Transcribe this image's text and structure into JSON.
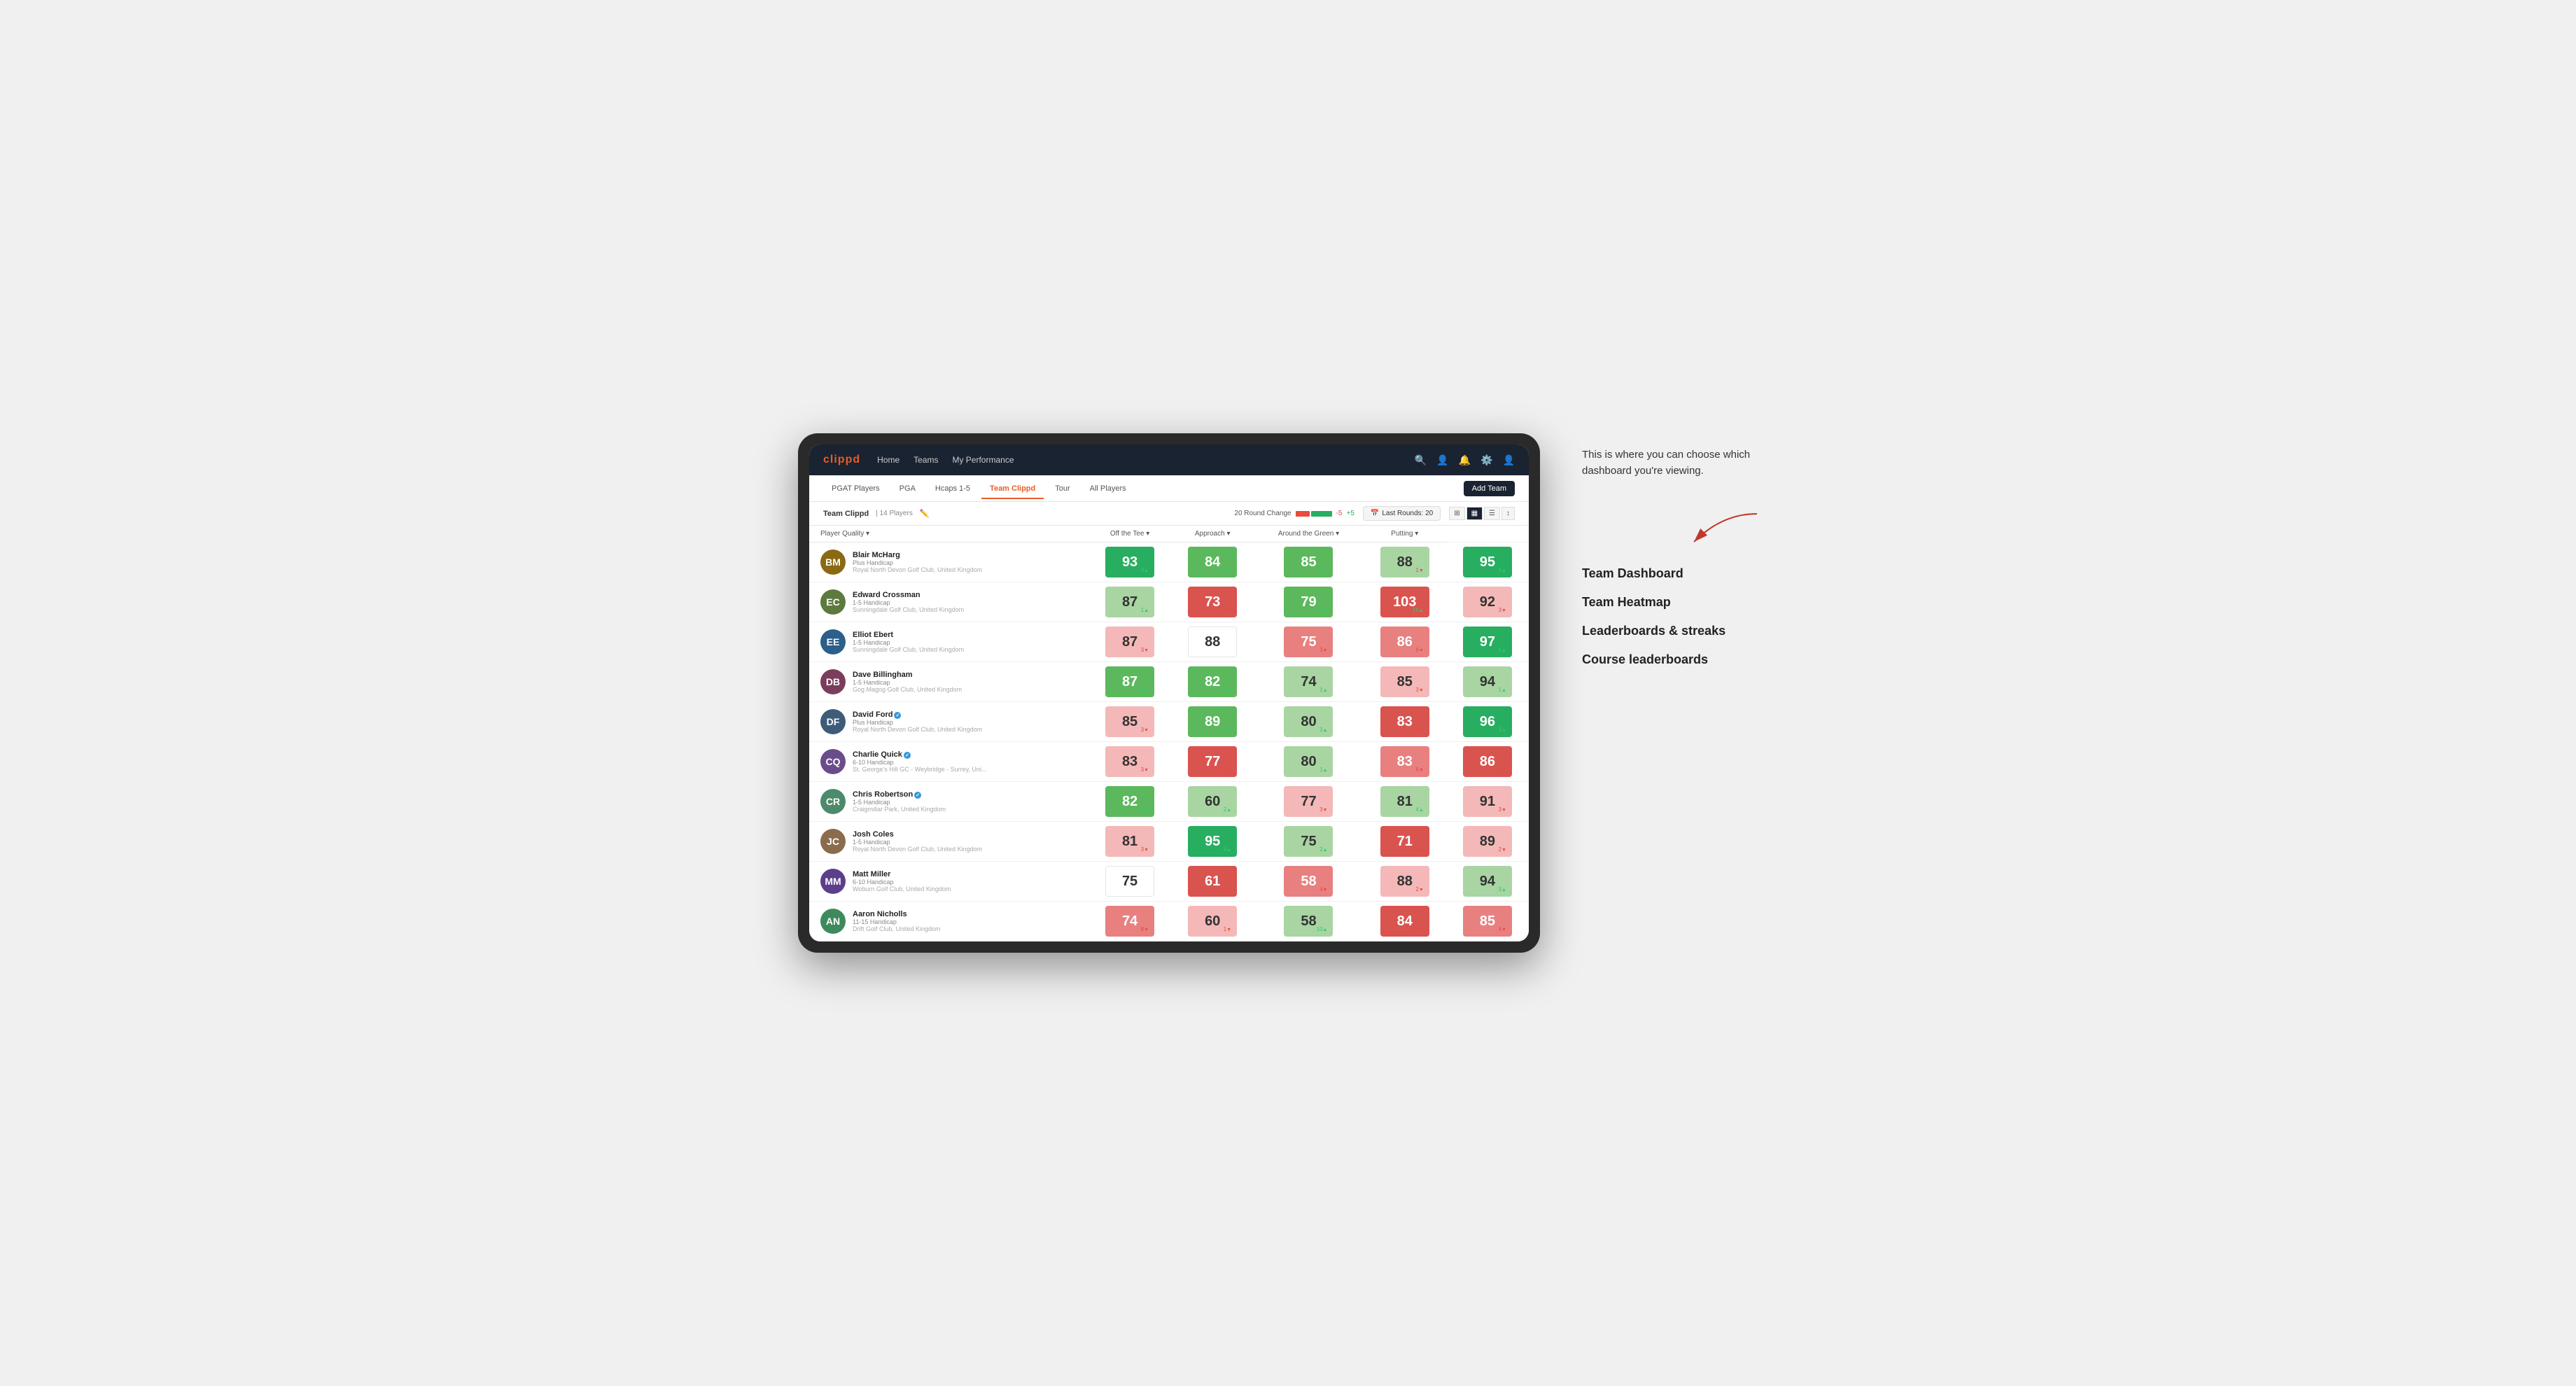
{
  "app": {
    "logo": "clippd",
    "nav_links": [
      "Home",
      "Teams",
      "My Performance"
    ],
    "tabs": [
      "PGAT Players",
      "PGA",
      "Hcaps 1-5",
      "Team Clippd",
      "Tour",
      "All Players"
    ],
    "active_tab": "Team Clippd",
    "add_team_label": "Add Team"
  },
  "sub_header": {
    "team_name": "Team Clippd",
    "separator": "|",
    "player_count": "14 Players",
    "round_change_label": "20 Round Change",
    "change_minus": "-5",
    "change_plus": "+5",
    "last_rounds_label": "Last Rounds:",
    "last_rounds_value": "20"
  },
  "table": {
    "columns": [
      "Player Quality ▾",
      "Off the Tee ▾",
      "Approach ▾",
      "Around the Green ▾",
      "Putting ▾"
    ],
    "rows": [
      {
        "name": "Blair McHarg",
        "handicap": "Plus Handicap",
        "club": "Royal North Devon Golf Club, United Kingdom",
        "scores": [
          {
            "value": "93",
            "change": "9",
            "dir": "up",
            "color": "green-dark"
          },
          {
            "value": "84",
            "change": "6",
            "dir": "up",
            "color": "green-light"
          },
          {
            "value": "85",
            "change": "8",
            "dir": "up",
            "color": "green-light"
          },
          {
            "value": "88",
            "change": "1",
            "dir": "down",
            "color": "green-pale"
          },
          {
            "value": "95",
            "change": "9",
            "dir": "up",
            "color": "green-dark"
          }
        ]
      },
      {
        "name": "Edward Crossman",
        "handicap": "1-5 Handicap",
        "club": "Sunningdale Golf Club, United Kingdom",
        "scores": [
          {
            "value": "87",
            "change": "1",
            "dir": "up",
            "color": "green-pale"
          },
          {
            "value": "73",
            "change": "11",
            "dir": "down",
            "color": "red-dark"
          },
          {
            "value": "79",
            "change": "9",
            "dir": "up",
            "color": "green-light"
          },
          {
            "value": "103",
            "change": "15",
            "dir": "up",
            "color": "red-dark"
          },
          {
            "value": "92",
            "change": "3",
            "dir": "down",
            "color": "red-pale"
          }
        ]
      },
      {
        "name": "Elliot Ebert",
        "handicap": "1-5 Handicap",
        "club": "Sunningdale Golf Club, United Kingdom",
        "scores": [
          {
            "value": "87",
            "change": "3",
            "dir": "down",
            "color": "red-pale"
          },
          {
            "value": "88",
            "change": "",
            "dir": "",
            "color": "white-bg"
          },
          {
            "value": "75",
            "change": "3",
            "dir": "down",
            "color": "red-light"
          },
          {
            "value": "86",
            "change": "6",
            "dir": "down",
            "color": "red-light"
          },
          {
            "value": "97",
            "change": "5",
            "dir": "up",
            "color": "green-dark"
          }
        ]
      },
      {
        "name": "Dave Billingham",
        "handicap": "1-5 Handicap",
        "club": "Gog Magog Golf Club, United Kingdom",
        "scores": [
          {
            "value": "87",
            "change": "4",
            "dir": "up",
            "color": "green-light"
          },
          {
            "value": "82",
            "change": "4",
            "dir": "up",
            "color": "green-light"
          },
          {
            "value": "74",
            "change": "1",
            "dir": "up",
            "color": "green-pale"
          },
          {
            "value": "85",
            "change": "3",
            "dir": "down",
            "color": "red-pale"
          },
          {
            "value": "94",
            "change": "1",
            "dir": "up",
            "color": "green-pale"
          }
        ]
      },
      {
        "name": "David Ford",
        "handicap": "Plus Handicap",
        "club": "Royal North Devon Golf Club, United Kingdom",
        "verified": true,
        "scores": [
          {
            "value": "85",
            "change": "3",
            "dir": "down",
            "color": "red-pale"
          },
          {
            "value": "89",
            "change": "7",
            "dir": "up",
            "color": "green-light"
          },
          {
            "value": "80",
            "change": "3",
            "dir": "up",
            "color": "green-pale"
          },
          {
            "value": "83",
            "change": "10",
            "dir": "down",
            "color": "red-dark"
          },
          {
            "value": "96",
            "change": "3",
            "dir": "up",
            "color": "green-dark"
          }
        ]
      },
      {
        "name": "Charlie Quick",
        "handicap": "6-10 Handicap",
        "club": "St. George's Hill GC - Weybridge - Surrey, Uni...",
        "verified": true,
        "scores": [
          {
            "value": "83",
            "change": "3",
            "dir": "down",
            "color": "red-pale"
          },
          {
            "value": "77",
            "change": "14",
            "dir": "down",
            "color": "red-dark"
          },
          {
            "value": "80",
            "change": "1",
            "dir": "up",
            "color": "green-pale"
          },
          {
            "value": "83",
            "change": "6",
            "dir": "down",
            "color": "red-light"
          },
          {
            "value": "86",
            "change": "8",
            "dir": "down",
            "color": "red-dark"
          }
        ]
      },
      {
        "name": "Chris Robertson",
        "handicap": "1-5 Handicap",
        "club": "Craigmillar Park, United Kingdom",
        "verified": true,
        "scores": [
          {
            "value": "82",
            "change": "3",
            "dir": "up",
            "color": "green-light"
          },
          {
            "value": "60",
            "change": "2",
            "dir": "up",
            "color": "green-pale"
          },
          {
            "value": "77",
            "change": "3",
            "dir": "down",
            "color": "red-pale"
          },
          {
            "value": "81",
            "change": "4",
            "dir": "up",
            "color": "green-pale"
          },
          {
            "value": "91",
            "change": "3",
            "dir": "down",
            "color": "red-pale"
          }
        ]
      },
      {
        "name": "Josh Coles",
        "handicap": "1-5 Handicap",
        "club": "Royal North Devon Golf Club, United Kingdom",
        "scores": [
          {
            "value": "81",
            "change": "3",
            "dir": "down",
            "color": "red-pale"
          },
          {
            "value": "95",
            "change": "8",
            "dir": "up",
            "color": "green-dark"
          },
          {
            "value": "75",
            "change": "2",
            "dir": "up",
            "color": "green-pale"
          },
          {
            "value": "71",
            "change": "11",
            "dir": "down",
            "color": "red-dark"
          },
          {
            "value": "89",
            "change": "2",
            "dir": "down",
            "color": "red-pale"
          }
        ]
      },
      {
        "name": "Matt Miller",
        "handicap": "6-10 Handicap",
        "club": "Woburn Golf Club, United Kingdom",
        "scores": [
          {
            "value": "75",
            "change": "",
            "dir": "",
            "color": "white-bg"
          },
          {
            "value": "61",
            "change": "3",
            "dir": "down",
            "color": "red-dark"
          },
          {
            "value": "58",
            "change": "4",
            "dir": "down",
            "color": "red-light"
          },
          {
            "value": "88",
            "change": "2",
            "dir": "down",
            "color": "red-pale"
          },
          {
            "value": "94",
            "change": "3",
            "dir": "up",
            "color": "green-pale"
          }
        ]
      },
      {
        "name": "Aaron Nicholls",
        "handicap": "11-15 Handicap",
        "club": "Drift Golf Club, United Kingdom",
        "scores": [
          {
            "value": "74",
            "change": "8",
            "dir": "down",
            "color": "red-light"
          },
          {
            "value": "60",
            "change": "1",
            "dir": "down",
            "color": "red-pale"
          },
          {
            "value": "58",
            "change": "10",
            "dir": "up",
            "color": "green-pale"
          },
          {
            "value": "84",
            "change": "21",
            "dir": "down",
            "color": "red-dark"
          },
          {
            "value": "85",
            "change": "4",
            "dir": "down",
            "color": "red-light"
          }
        ]
      }
    ]
  },
  "annotation": {
    "intro": "This is where you can choose which dashboard you're viewing.",
    "options": [
      "Team Dashboard",
      "Team Heatmap",
      "Leaderboards & streaks",
      "Course leaderboards"
    ]
  }
}
